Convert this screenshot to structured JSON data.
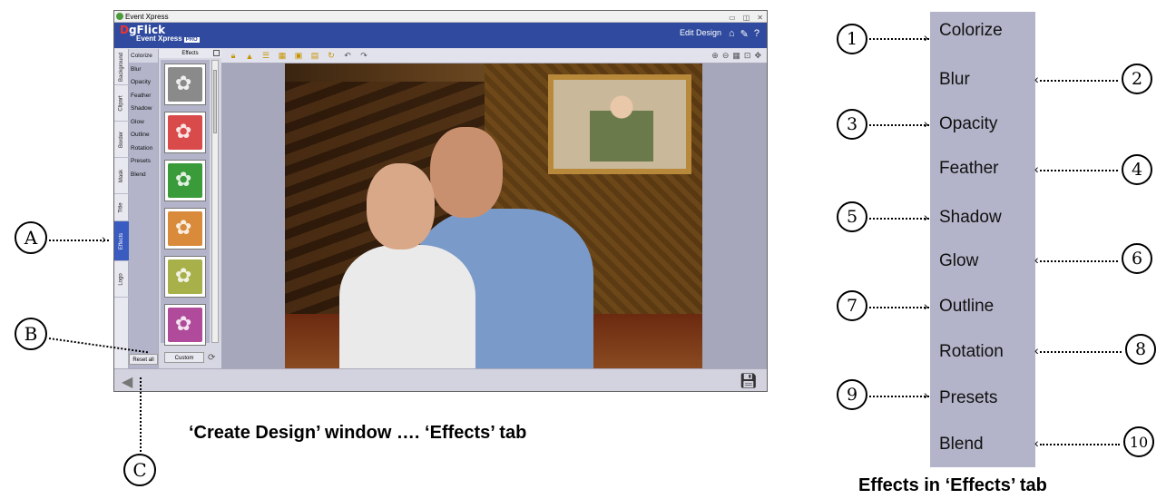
{
  "window": {
    "title": "Event Xpress",
    "brand_main": "gFlick",
    "brand_prefix": "D",
    "brand_sub": "Event Xpress",
    "brand_badge": "PRO",
    "edit_design": "Edit Design",
    "home_icon": "home-icon",
    "wrench_icon": "wrench-icon",
    "help_label": "?"
  },
  "vertical_tabs": [
    "Background",
    "Clipart",
    "Border",
    "Mask",
    "Title",
    "Effects",
    "Logo"
  ],
  "active_tab": "Effects",
  "effects_list": [
    "Colorize",
    "Blur",
    "Opacity",
    "Feather",
    "Shadow",
    "Glow",
    "Outline",
    "Rotation",
    "Presets",
    "Blend"
  ],
  "effects_panel_title": "Effects",
  "reset_all": "Reset all",
  "custom_button": "Custom",
  "thumb_colors": [
    "#8a8a8a",
    "#d94a4a",
    "#3a9b3a",
    "#d98a3a",
    "#a8b04a",
    "#b04a9b"
  ],
  "callouts_left": {
    "A": "A",
    "B": "B",
    "C": "C"
  },
  "caption_left": "‘Create Design’ window …. ‘Effects’ tab",
  "caption_right": "Effects in ‘Effects’ tab",
  "numbers": [
    "1",
    "2",
    "3",
    "4",
    "5",
    "6",
    "7",
    "8",
    "9",
    "10"
  ],
  "colors": {
    "header": "#2f4a9e",
    "active_tab": "#3a5bbf",
    "panel": "#b3b4c9"
  }
}
